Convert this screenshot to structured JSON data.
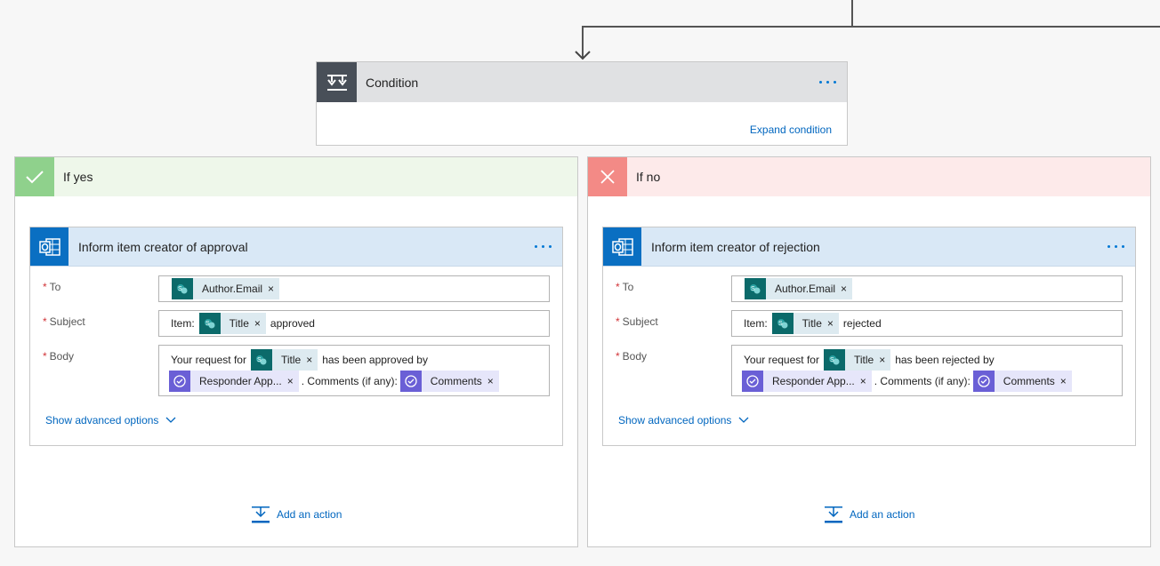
{
  "colors": {
    "link": "#0066bf",
    "condition_icon_bg": "#484f58",
    "yes_icon_bg": "#8fd18c",
    "no_icon_bg": "#f38a86",
    "outlook_blue": "#0a6fc2",
    "sharepoint_teal": "#0b6a6a",
    "approvals_purple": "#6a5fd6"
  },
  "condition": {
    "title": "Condition",
    "expand_label": "Expand condition",
    "icon": "condition-icon"
  },
  "yes_branch": {
    "title": "If yes",
    "icon": "check-icon",
    "action": {
      "title": "Inform item creator of approval",
      "icon": "outlook-icon",
      "to_label": "To",
      "to_token": "Author.Email",
      "subject_label": "Subject",
      "subject_prefix": "Item:",
      "subject_token": "Title",
      "subject_suffix": "approved",
      "body_label": "Body",
      "body_prefix": "Your request for",
      "body_token1": "Title",
      "body_middle": "has been approved by",
      "body_token2": "Responder App...",
      "body_comments_text": ". Comments (if any):",
      "body_token3": "Comments",
      "remove_glyph": "×",
      "advanced_label": "Show advanced options"
    },
    "add_action_label": "Add an action"
  },
  "no_branch": {
    "title": "If no",
    "icon": "close-icon",
    "action": {
      "title": "Inform item creator of rejection",
      "icon": "outlook-icon",
      "to_label": "To",
      "to_token": "Author.Email",
      "subject_label": "Subject",
      "subject_prefix": "Item:",
      "subject_token": "Title",
      "subject_suffix": "rejected",
      "body_label": "Body",
      "body_prefix": "Your request for",
      "body_token1": "Title",
      "body_middle": "has been rejected by",
      "body_token2": "Responder App...",
      "body_comments_text": ". Comments (if any):",
      "body_token3": "Comments",
      "remove_glyph": "×",
      "advanced_label": "Show advanced options"
    },
    "add_action_label": "Add an action"
  }
}
